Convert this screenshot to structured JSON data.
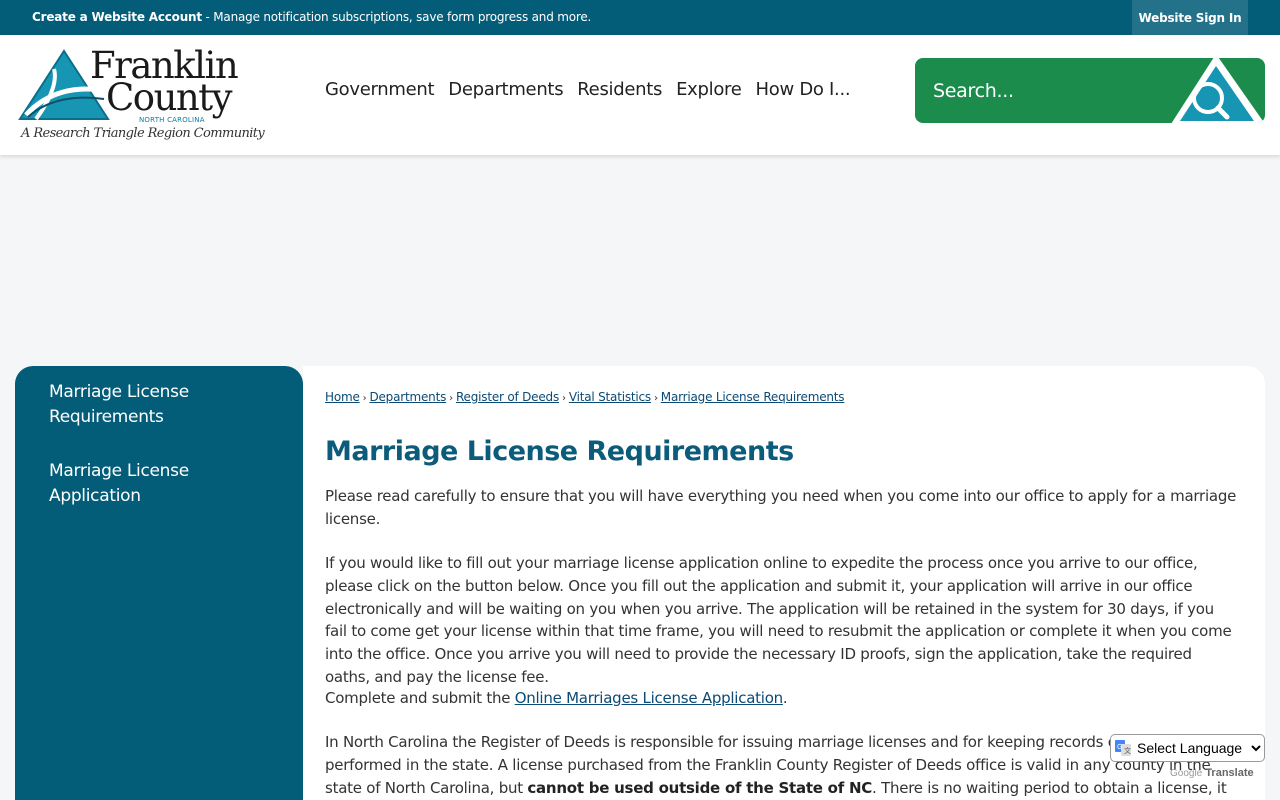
{
  "topbar": {
    "account_link": "Create a Website Account",
    "account_desc": " - Manage notification subscriptions, save form progress and more.",
    "signin": "Website Sign In"
  },
  "logo": {
    "name_line1": "Franklin",
    "name_line2": "County",
    "state": "NORTH CAROLINA",
    "tagline": "A Research Triangle Region Community"
  },
  "nav": [
    "Government",
    "Departments",
    "Residents",
    "Explore",
    "How Do I..."
  ],
  "search": {
    "placeholder": "Search..."
  },
  "sidebar": {
    "items": [
      {
        "label": "Marriage License Requirements"
      },
      {
        "label": "Marriage License Application"
      }
    ]
  },
  "breadcrumb": [
    "Home",
    "Departments",
    "Register of Deeds",
    "Vital Statistics",
    "Marriage License Requirements"
  ],
  "main": {
    "title": "Marriage License Requirements",
    "p1": "Please read carefully to ensure that you will have everything you need when you come into our office to apply for a marriage license.",
    "p2": "If you would like to fill out your marriage license application online to expedite the process once you arrive to our office, please click on the button below. Once you fill out the application and submit it, your application will arrive in our office electronically and will be waiting on you when you arrive. The application will be retained in the system for 30 days, if you fail to come get your license within that time frame, you will need to resubmit the application or complete it when you come into the office. Once you arrive you will need to provide the necessary ID proofs, sign the application, take the required oaths, and pay the license fee.",
    "p3_before": "Complete and submit the ",
    "p3_link": "Online Marriages License Application",
    "p3_after": ".",
    "p4_before": "In North Carolina the Register of Deeds is responsible for issuing marriage licenses and for keeping records of all marriages performed in the state. A license purchased from the Franklin County Register of Deeds office is valid in any county in the state of North Carolina, but ",
    "p4_bold": "cannot be used outside of the State of NC",
    "p4_after": ". There is no waiting period to obtain a license, it is good"
  },
  "translate": {
    "select_label": "Select Language",
    "powered_by": "Powered by",
    "google": "Google",
    "translate": "Translate"
  },
  "colors": {
    "brand_teal": "#045d78",
    "search_green": "#1b8c4b",
    "heading": "#0b5b7a",
    "link": "#0b4a75"
  }
}
